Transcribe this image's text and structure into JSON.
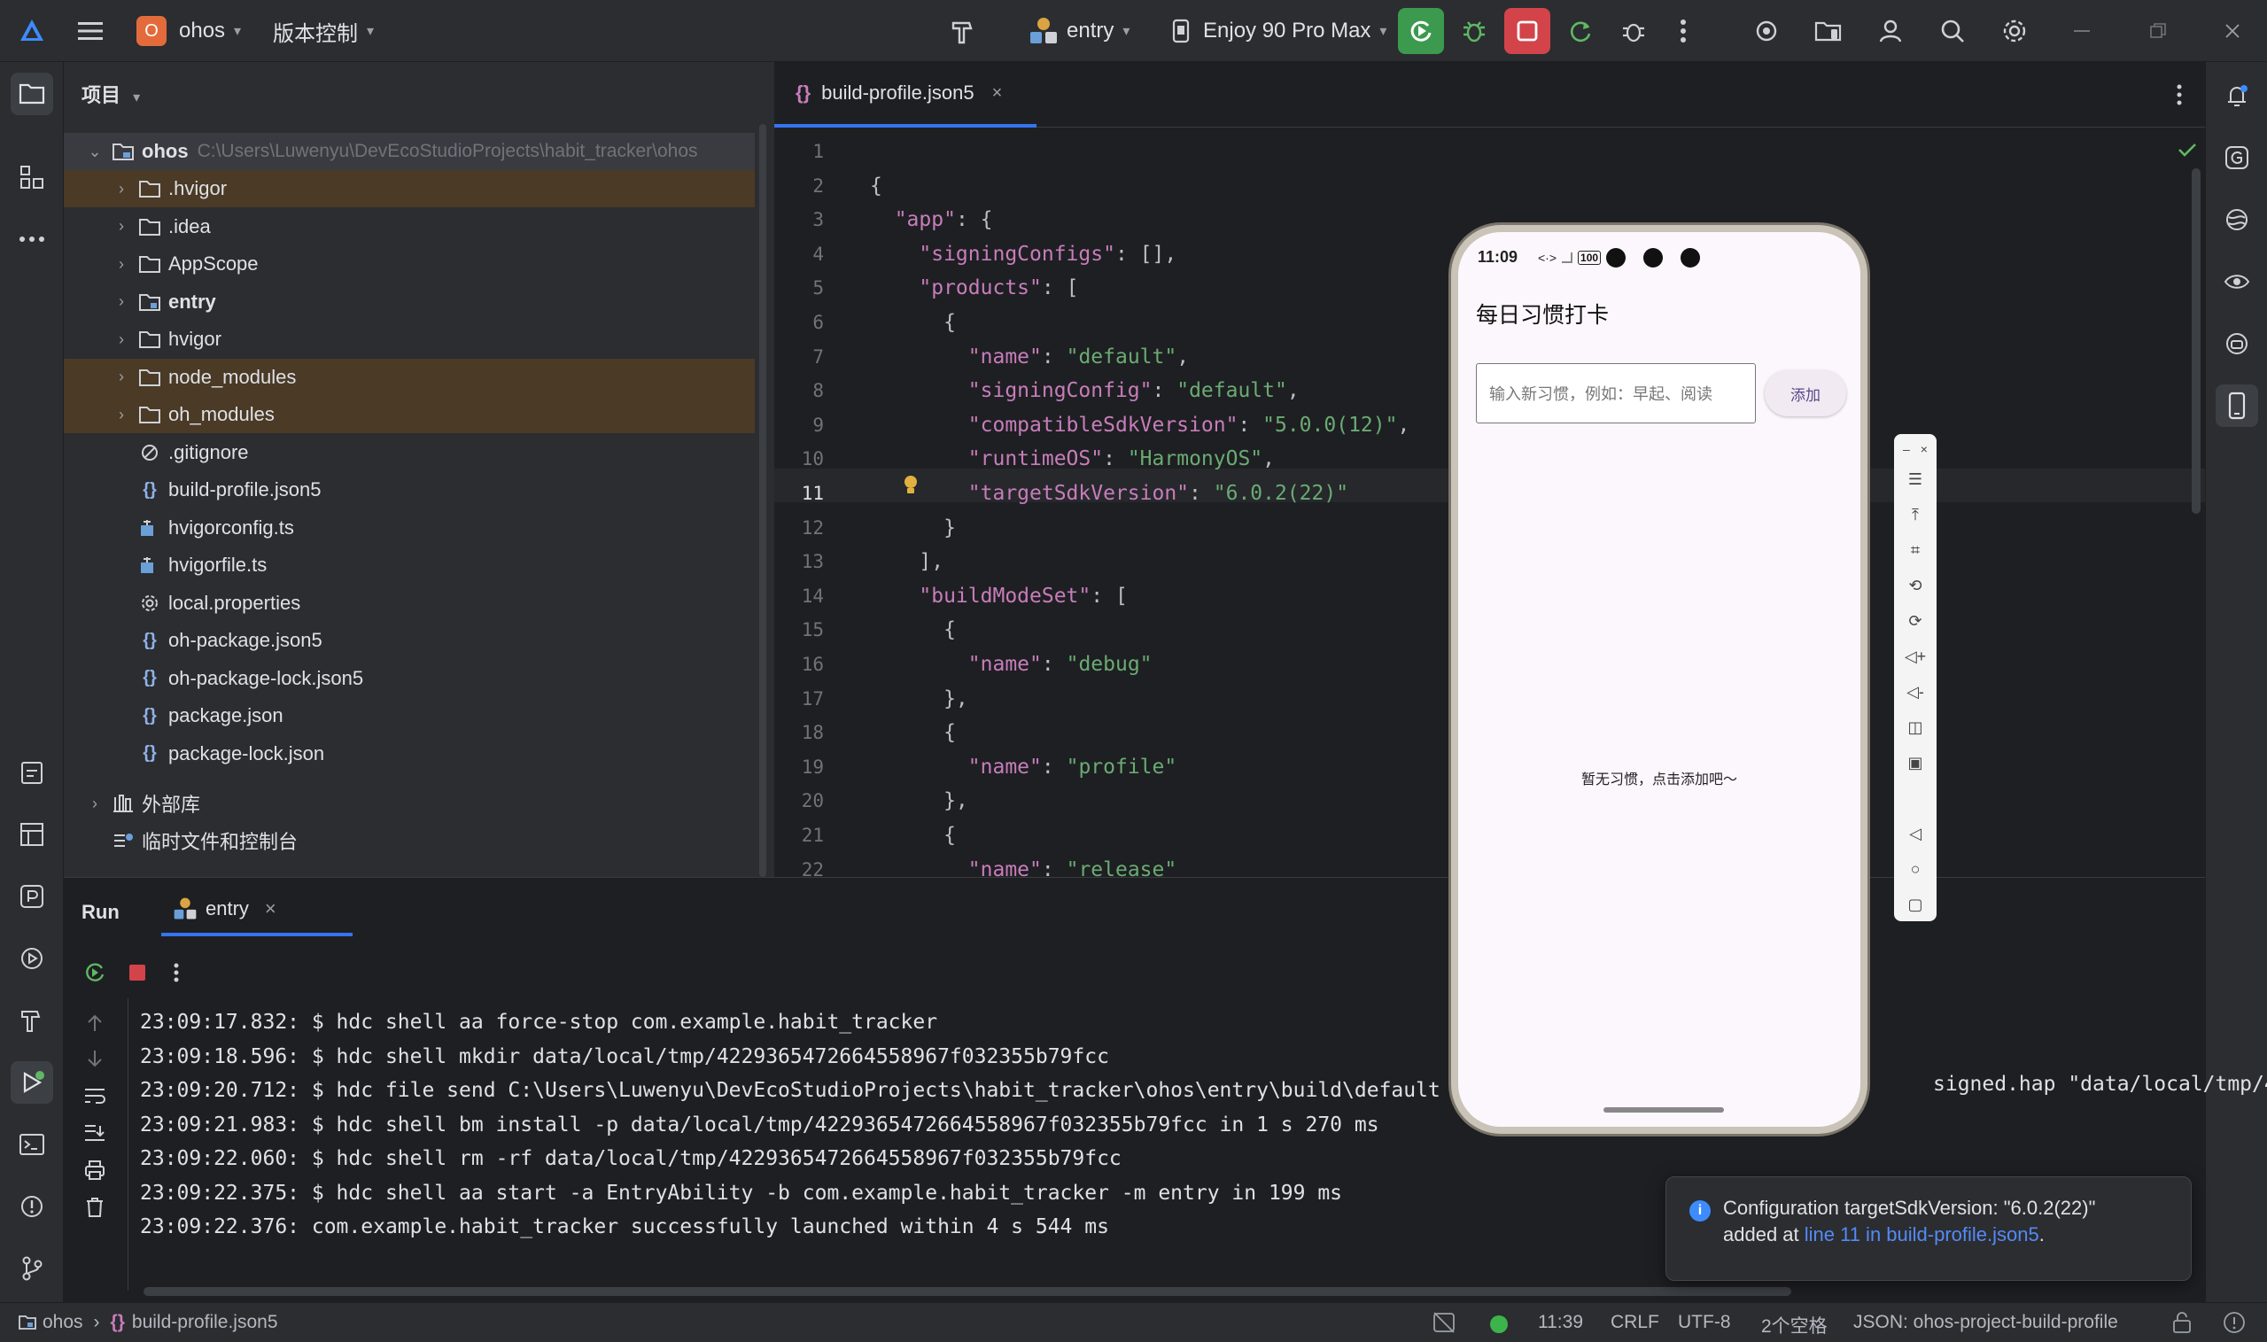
{
  "titlebar": {
    "project_badge": "O",
    "project_name": "ohos",
    "vcs_menu": "版本控制",
    "run_config": "entry",
    "device": "Enjoy 90 Pro Max"
  },
  "project_panel": {
    "title": "项目",
    "root": {
      "name": "ohos",
      "path": "C:\\Users\\Luwenyu\\DevEcoStudioProjects\\habit_tracker\\ohos"
    },
    "items": [
      {
        "label": ".hvigor",
        "kind": "folder",
        "excluded": true
      },
      {
        "label": ".idea",
        "kind": "folder",
        "excluded": false
      },
      {
        "label": "AppScope",
        "kind": "folder",
        "excluded": false
      },
      {
        "label": "entry",
        "kind": "module",
        "excluded": false
      },
      {
        "label": "hvigor",
        "kind": "folder",
        "excluded": false
      },
      {
        "label": "node_modules",
        "kind": "folder",
        "excluded": true
      },
      {
        "label": "oh_modules",
        "kind": "folder",
        "excluded": true
      },
      {
        "label": ".gitignore",
        "kind": "ignore"
      },
      {
        "label": "build-profile.json5",
        "kind": "json"
      },
      {
        "label": "hvigorconfig.ts",
        "kind": "ts"
      },
      {
        "label": "hvigorfile.ts",
        "kind": "ts"
      },
      {
        "label": "local.properties",
        "kind": "settings"
      },
      {
        "label": "oh-package.json5",
        "kind": "json"
      },
      {
        "label": "oh-package-lock.json5",
        "kind": "json"
      },
      {
        "label": "package.json",
        "kind": "json"
      },
      {
        "label": "package-lock.json",
        "kind": "json"
      }
    ],
    "external_libs": "外部库",
    "scratches": "临时文件和控制台"
  },
  "editor": {
    "tab": "build-profile.json5",
    "lines": [
      {
        "n": "1",
        "t": ""
      },
      {
        "n": "2",
        "t": "{"
      },
      {
        "n": "3",
        "t": "  \"app\": {"
      },
      {
        "n": "4",
        "t": "    \"signingConfigs\": [],"
      },
      {
        "n": "5",
        "t": "    \"products\": ["
      },
      {
        "n": "6",
        "t": "      {"
      },
      {
        "n": "7",
        "t": "        \"name\": \"default\","
      },
      {
        "n": "8",
        "t": "        \"signingConfig\": \"default\","
      },
      {
        "n": "9",
        "t": "        \"compatibleSdkVersion\": \"5.0.0(12)\","
      },
      {
        "n": "10",
        "t": "        \"runtimeOS\": \"HarmonyOS\","
      },
      {
        "n": "11",
        "t": "        \"targetSdkVersion\": \"6.0.2(22)\""
      },
      {
        "n": "12",
        "t": "      }"
      },
      {
        "n": "13",
        "t": "    ],"
      },
      {
        "n": "14",
        "t": "    \"buildModeSet\": ["
      },
      {
        "n": "15",
        "t": "      {"
      },
      {
        "n": "16",
        "t": "        \"name\": \"debug\""
      },
      {
        "n": "17",
        "t": "      },"
      },
      {
        "n": "18",
        "t": "      {"
      },
      {
        "n": "19",
        "t": "        \"name\": \"profile\""
      },
      {
        "n": "20",
        "t": "      },"
      },
      {
        "n": "21",
        "t": "      {"
      },
      {
        "n": "22",
        "t": "        \"name\": \"release\""
      }
    ]
  },
  "run_panel": {
    "title": "Run",
    "tab": "entry",
    "logs": [
      "23:09:17.832: $ hdc shell aa force-stop com.example.habit_tracker",
      "23:09:18.596: $ hdc shell mkdir data/local/tmp/4229365472664558967f032355b79fcc",
      "23:09:20.712: $ hdc file send C:\\Users\\Luwenyu\\DevEcoStudioProjects\\habit_tracker\\ohos\\entry\\build\\default",
      "23:09:21.983: $ hdc shell bm install -p data/local/tmp/4229365472664558967f032355b79fcc in 1 s 270 ms",
      "23:09:22.060: $ hdc shell rm -rf data/local/tmp/4229365472664558967f032355b79fcc",
      "23:09:22.375: $ hdc shell aa start -a EntryAbility -b com.example.habit_tracker -m entry in 199 ms",
      "23:09:22.376: com.example.habit_tracker successfully launched within 4 s 544 ms"
    ],
    "log_overflow": "signed.hap \"data/local/tmp/4"
  },
  "phone": {
    "time": "11:09",
    "battery": "100",
    "app_title": "每日习惯打卡",
    "input_placeholder": "输入新习惯，例如：早起、阅读",
    "add_button": "添加",
    "empty_text": "暂无习惯，点击添加吧～"
  },
  "notification": {
    "line1": "Configuration targetSdkVersion: \"6.0.2(22)\"",
    "line2_prefix": "added at ",
    "link": "line 11 in build-profile.json5",
    "line2_suffix": "."
  },
  "statusbar": {
    "crumb_root": "ohos",
    "crumb_file": "build-profile.json5",
    "position": "11:39",
    "line_sep": "CRLF",
    "encoding": "UTF-8",
    "indent": "2个空格",
    "schema": "JSON: ohos-project-build-profile"
  },
  "colors": {
    "accent": "#3574f0",
    "excluded_bg": "#4a3a26",
    "run_green": "#3c9a4e",
    "stop_red": "#d2444a",
    "string_green": "#6aab73",
    "key_purple": "#c77dbb"
  }
}
